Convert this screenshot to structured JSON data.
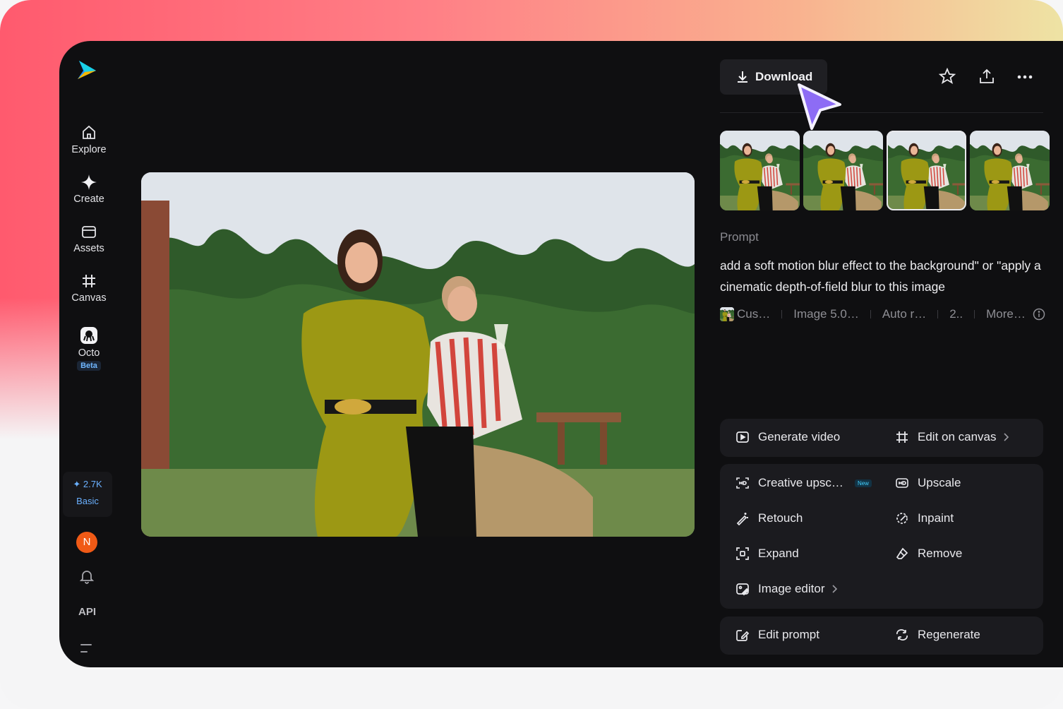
{
  "nav": {
    "explore": "Explore",
    "create": "Create",
    "assets": "Assets",
    "canvas": "Canvas",
    "octo": "Octo",
    "octo_badge": "Beta"
  },
  "credits": {
    "amount": "✦ 2.7K",
    "plan": "Basic"
  },
  "user": {
    "avatar_initial": "N"
  },
  "api_label": "API",
  "toolbar": {
    "download_label": "Download"
  },
  "thumbnails": {
    "count": 4,
    "selected_index": 2
  },
  "prompt": {
    "label": "Prompt",
    "text": "add a soft motion blur effect to the background\" or \"apply a cinematic depth-of-field blur to this image"
  },
  "meta": {
    "style": "Cus…",
    "model": "Image 5.0…",
    "ratio": "Auto r…",
    "count": "2..",
    "more": "More…"
  },
  "actions": {
    "generate_video": "Generate video",
    "edit_on_canvas": "Edit on canvas",
    "creative_upscale": "Creative upsc…",
    "new_badge": "New",
    "upscale": "Upscale",
    "retouch": "Retouch",
    "inpaint": "Inpaint",
    "expand": "Expand",
    "remove": "Remove",
    "image_editor": "Image editor",
    "edit_prompt": "Edit prompt",
    "regenerate": "Regenerate"
  },
  "colors": {
    "app_bg": "#0f0f11",
    "panel_bg": "#1b1b1f",
    "accent_cursor": "#8d6cf5",
    "credits_blue": "#6ab0ff",
    "avatar_orange": "#f05a16"
  }
}
